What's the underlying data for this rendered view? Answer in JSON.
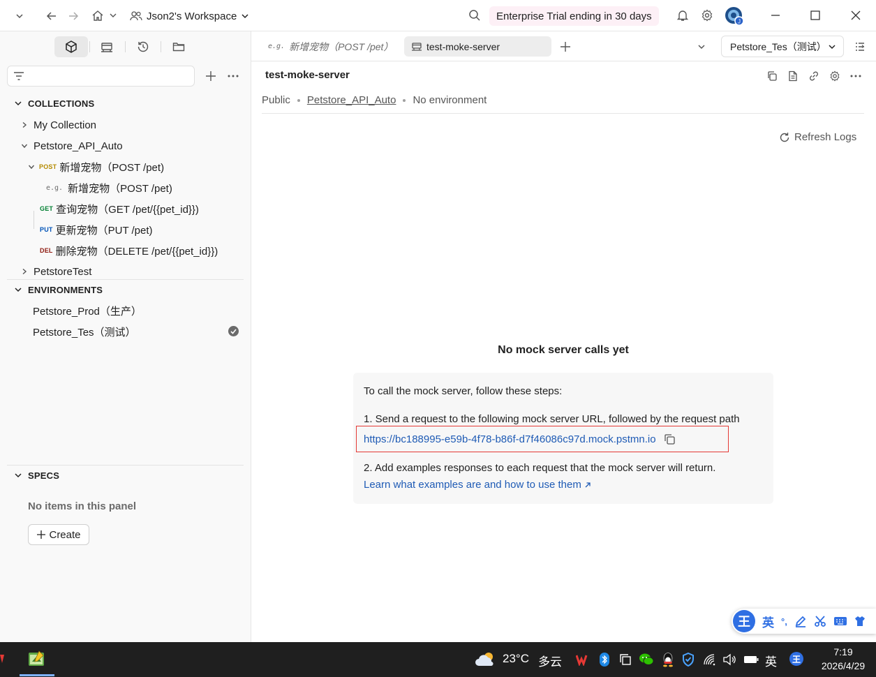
{
  "topbar": {
    "workspace_name": "Json2's Workspace",
    "trial_badge": "Enterprise Trial ending in 30 days"
  },
  "sidebar": {
    "collections_header": "COLLECTIONS",
    "collections": {
      "my_collection": "My Collection",
      "petstore_api_auto": "Petstore_API_Auto",
      "req_post": {
        "method": "POST",
        "label": "新增宠物（POST /pet)"
      },
      "example": {
        "icon": "e.g.",
        "label": "新增宠物（POST /pet)"
      },
      "req_get": {
        "method": "GET",
        "label": "查询宠物（GET /pet/{{pet_id}})"
      },
      "req_put": {
        "method": "PUT",
        "label": "更新宠物（PUT /pet)"
      },
      "req_del": {
        "method": "DEL",
        "label": "删除宠物（DELETE /pet/{{pet_id}})"
      },
      "petstore_test": "PetstoreTest"
    },
    "environments_header": "ENVIRONMENTS",
    "environments": {
      "prod": "Petstore_Prod（生产）",
      "test": "Petstore_Tes（测试）"
    },
    "specs_header": "SPECS",
    "specs_empty": "No items in this panel",
    "create_label": "Create"
  },
  "tabs": {
    "tab1": {
      "icon": "e.g.",
      "label": "新增宠物（POST /pet）"
    },
    "tab2": {
      "label": "test-moke-server"
    },
    "env_selected": "Petstore_Tes（测试）"
  },
  "main": {
    "title": "test-moke-server",
    "visibility": "Public",
    "collection_link": "Petstore_API_Auto",
    "environment": "No environment",
    "refresh_label": "Refresh Logs",
    "empty_title": "No mock server calls yet",
    "steps_intro": "To call the mock server, follow these steps:",
    "step1": "1. Send a request to the following mock server URL, followed by the request path",
    "mock_url": "https://bc188995-e59b-4f78-b86f-d7f46086c97d.mock.pstmn.io",
    "step2": "2. Add examples responses to each request that the mock server will return.",
    "learn_link": "Learn what examples are and how to use them"
  },
  "ime": {
    "logo": "王",
    "lang": "英",
    "punct": "°,"
  },
  "taskbar": {
    "weather_temp": "23°C",
    "weather_desc": "多云",
    "ime_lang": "英",
    "ime_logo": "王",
    "time": "7:19",
    "date": "2026/4/29"
  },
  "colors": {
    "accent_link": "#1f5bb5",
    "highlight_border": "#e53935",
    "trial_bg": "#fdf0f6",
    "post": "#b48a00",
    "get": "#007f31",
    "put": "#0053b8",
    "del": "#8e1a10"
  }
}
